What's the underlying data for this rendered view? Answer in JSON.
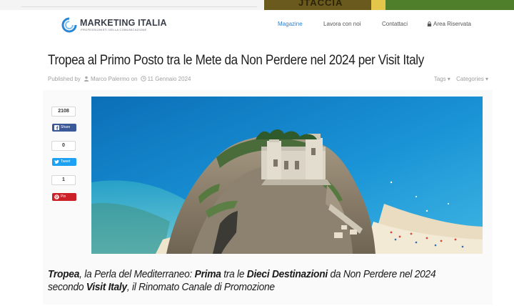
{
  "ad_banner": {
    "text": "JTACCIA"
  },
  "header": {
    "logo_name": "MARKETING ITALIA",
    "logo_tagline": "PROFESSIONISTI DELLA COMUNICAZIONE",
    "nav": [
      {
        "label": "Magazine",
        "active": true
      },
      {
        "label": "Lavora con noi",
        "active": false
      },
      {
        "label": "Contattaci",
        "active": false
      },
      {
        "label": "Area Riservata",
        "active": false
      }
    ]
  },
  "article": {
    "title": "Tropea al Primo Posto tra le Mete da Non Perdere nel 2024 per Visit Italy",
    "published_prefix": "Published by",
    "author": "Marco Palermo",
    "on_text": "on",
    "date": "11 Gennaio 2024",
    "tags_label": "Tags ▾",
    "categories_label": "Categories ▾",
    "intro": {
      "part1_bold": "Tropea",
      "part2": ", la Perla del Mediterraneo: ",
      "part3_bold": "Prima",
      "part4": " tra le ",
      "part5_bold": "Dieci Destinazioni",
      "part6": " da Non Perdere nel 2024 secondo ",
      "part7_bold": "Visit Italy",
      "part8": ", il Rinomato Canale di Promozione"
    }
  },
  "share": {
    "facebook": {
      "count": "2108",
      "label": "Share"
    },
    "twitter": {
      "count": "0",
      "label": "Tweet"
    },
    "pinterest": {
      "count": "1",
      "label": "Pin"
    }
  },
  "colors": {
    "accent": "#2a7fd4",
    "facebook": "#3b5998",
    "twitter": "#1da1f2",
    "pinterest": "#cb2027"
  }
}
